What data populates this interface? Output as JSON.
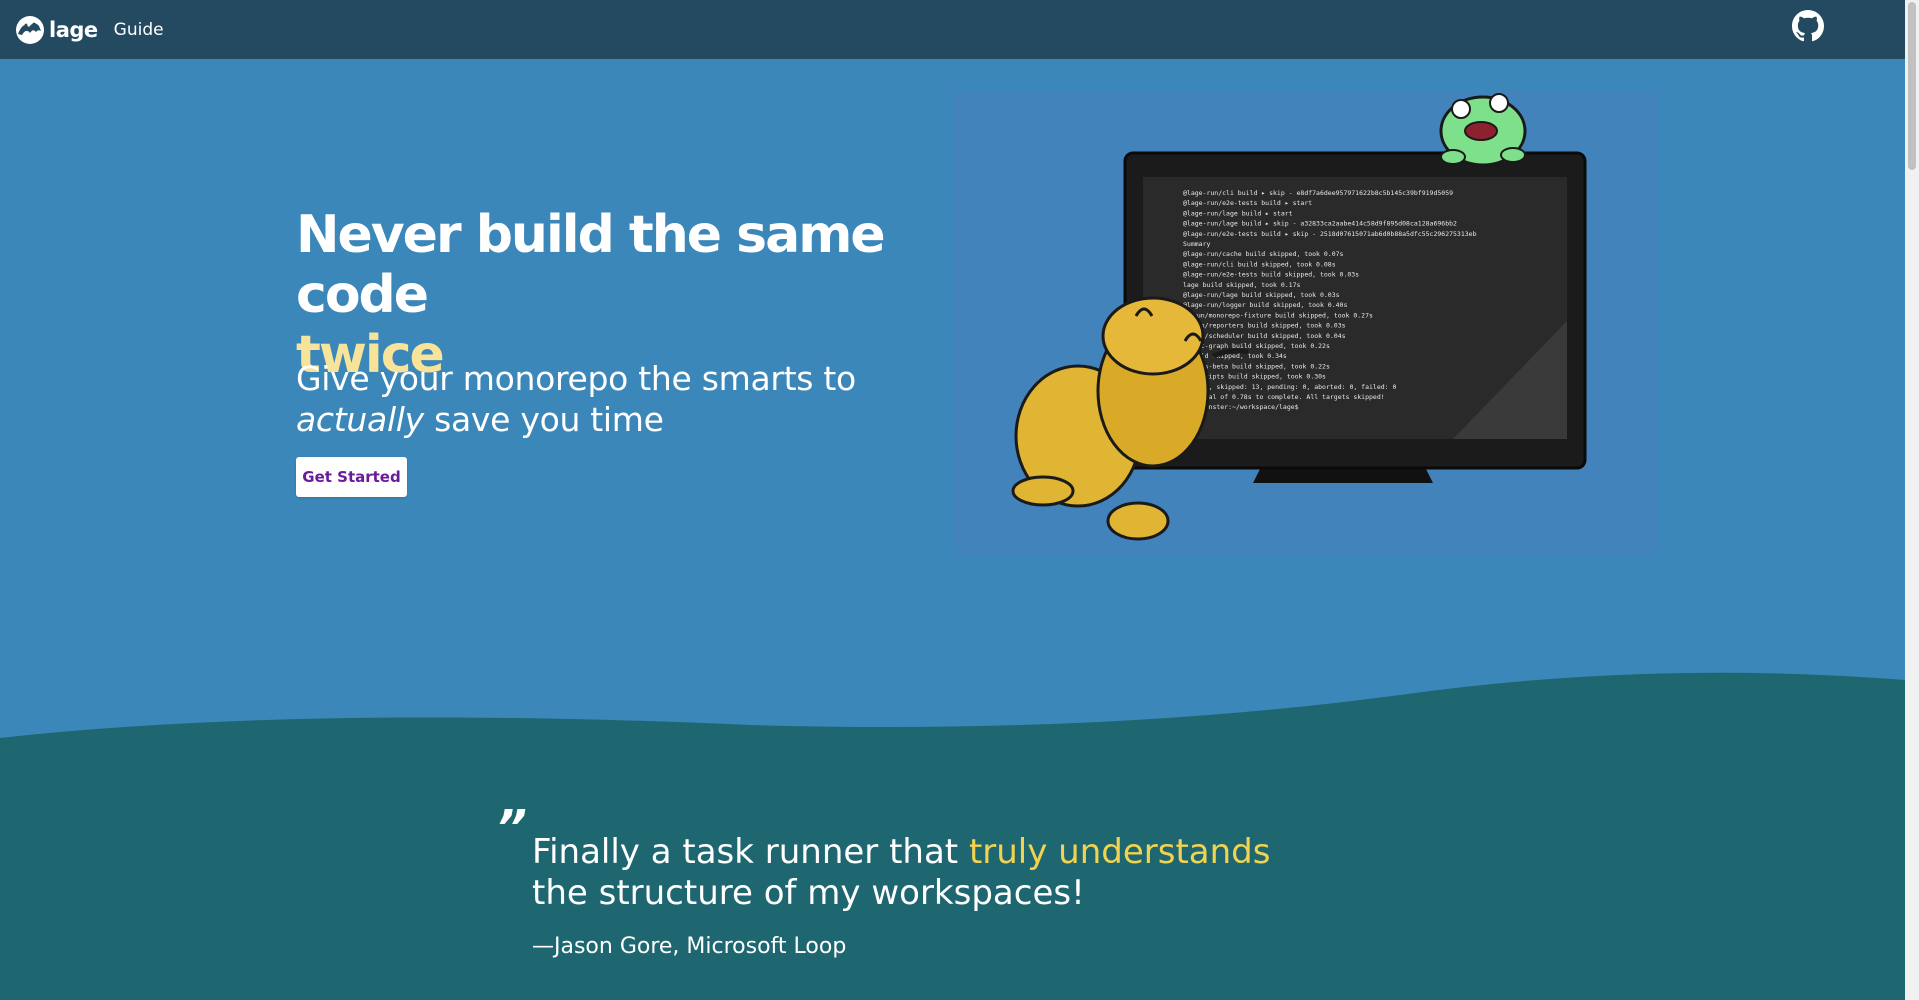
{
  "nav": {
    "brand_name": "lage",
    "links": [
      {
        "label": "Guide"
      }
    ],
    "github_icon": "github-icon"
  },
  "hero": {
    "title_line1": "Never build the same code",
    "title_line2": "twice",
    "subtitle_part1": "Give your monorepo the smarts to",
    "subtitle_em": "actually",
    "subtitle_part2": " save you time",
    "cta_label": "Get Started"
  },
  "illustration": {
    "terminal_lines": [
      "@lage-run/cli build ▸ skip - e8df7a6dee957971622b8c5b145c39bf919d5059",
      "@lage-run/e2e-tests build ▸ start",
      "@lage-run/lage build ▸ start",
      "@lage-run/lage build ▸ skip - a32833ca2aabe414c58d9f895d08ca128a696bb2",
      "@lage-run/e2e-tests build ▸ skip - 2518d07615071ab6d0b88a5dfc55c296275313eb",
      "Summary",
      "@lage-run/cache build skipped, took 0.07s",
      "@lage-run/cli build skipped, took 0.08s",
      "@lage-run/e2e-tests build skipped, took 0.03s",
      "lage build skipped, took 0.17s",
      "@lage-run/lage build skipped, took 0.03s",
      "@lage-run/logger build skipped, took 0.40s",
      "-run/monorepo-fixture build skipped, took 0.27s",
      "-run/reporters build skipped, took 0.03s",
      "-run/scheduler build skipped, took 0.04s",
      "rget-graph build skipped, took 0.22s",
      "build skipped, took 0.34s",
      "/docs-beta build skipped, took 0.22s",
      "o-scripts build skipped, took 0.30s",
      "ss: 0, skipped: 13, pending: 0, aborted: 0, failed: 0",
      "a total of 0.78s to complete. All targets skipped!",
      "cromonster:~/workspace/lage$"
    ]
  },
  "testimonial": {
    "quote_mark": "”",
    "text_before": "Finally a task runner that ",
    "text_highlight": "truly understands",
    "text_after": " the structure of my workspaces!",
    "author": "—Jason Gore, Microsoft Loop"
  },
  "colors": {
    "nav_bg": "#244a62",
    "hero_bg": "#3b87b9",
    "wave_bg": "#1e6770",
    "accent_yellow": "#f8e39a",
    "highlight_yellow": "#f3d24f",
    "cta_text": "#6a1b9a"
  }
}
